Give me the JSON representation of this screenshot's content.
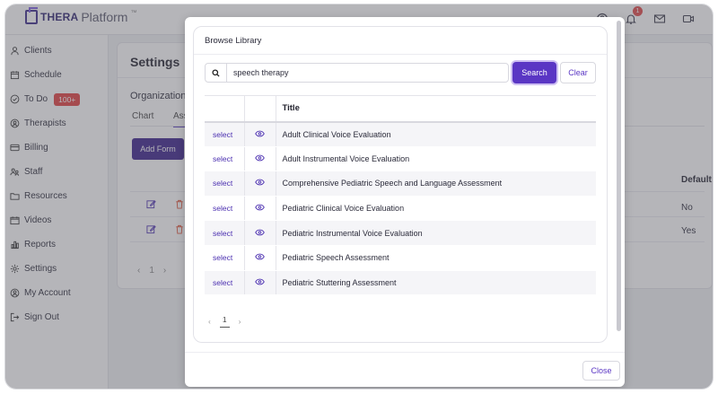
{
  "brand": {
    "thera": "THERA",
    "platform": "Platform",
    "tm": "™"
  },
  "header": {
    "notification_count": "1"
  },
  "sidebar": {
    "items": [
      {
        "label": "Clients",
        "icon": "user-icon"
      },
      {
        "label": "Schedule",
        "icon": "calendar-icon"
      },
      {
        "label": "To Do",
        "icon": "check-circle-icon",
        "badge": "100+"
      },
      {
        "label": "Therapists",
        "icon": "therapist-icon"
      },
      {
        "label": "Billing",
        "icon": "card-icon"
      },
      {
        "label": "Staff",
        "icon": "staff-icon"
      },
      {
        "label": "Resources",
        "icon": "folder-icon"
      },
      {
        "label": "Videos",
        "icon": "video-icon"
      },
      {
        "label": "Reports",
        "icon": "chart-icon"
      },
      {
        "label": "Settings",
        "icon": "gear-icon"
      },
      {
        "label": "My Account",
        "icon": "account-icon"
      },
      {
        "label": "Sign Out",
        "icon": "sign-out-icon"
      }
    ]
  },
  "settings": {
    "title": "Settings",
    "org_label": "Organization",
    "tabs": [
      "Chart",
      "Ass"
    ],
    "add_form": "Add Form",
    "default_header": "Default",
    "rows": [
      {
        "default": "No"
      },
      {
        "default": "Yes"
      }
    ],
    "page": "1"
  },
  "modal": {
    "title": "Browse Library",
    "search": {
      "value": "speech therapy",
      "placeholder": ""
    },
    "search_button": "Search",
    "clear_button": "Clear",
    "table": {
      "header_title": "Title",
      "select_label": "select",
      "rows": [
        "Adult Clinical Voice Evaluation",
        "Adult Instrumental Voice Evaluation",
        "Comprehensive Pediatric Speech and Language Assessment",
        "Pediatric Clinical Voice Evaluation",
        "Pediatric Instrumental Voice Evaluation",
        "Pediatric Speech Assessment",
        "Pediatric Stuttering Assessment"
      ]
    },
    "pagination": {
      "prev": "‹",
      "current": "1",
      "next": "›"
    },
    "close_button": "Close"
  },
  "colors": {
    "accent": "#5a36c4",
    "brand_dark": "#3a1f8a",
    "badge_red": "#e23e3e"
  }
}
